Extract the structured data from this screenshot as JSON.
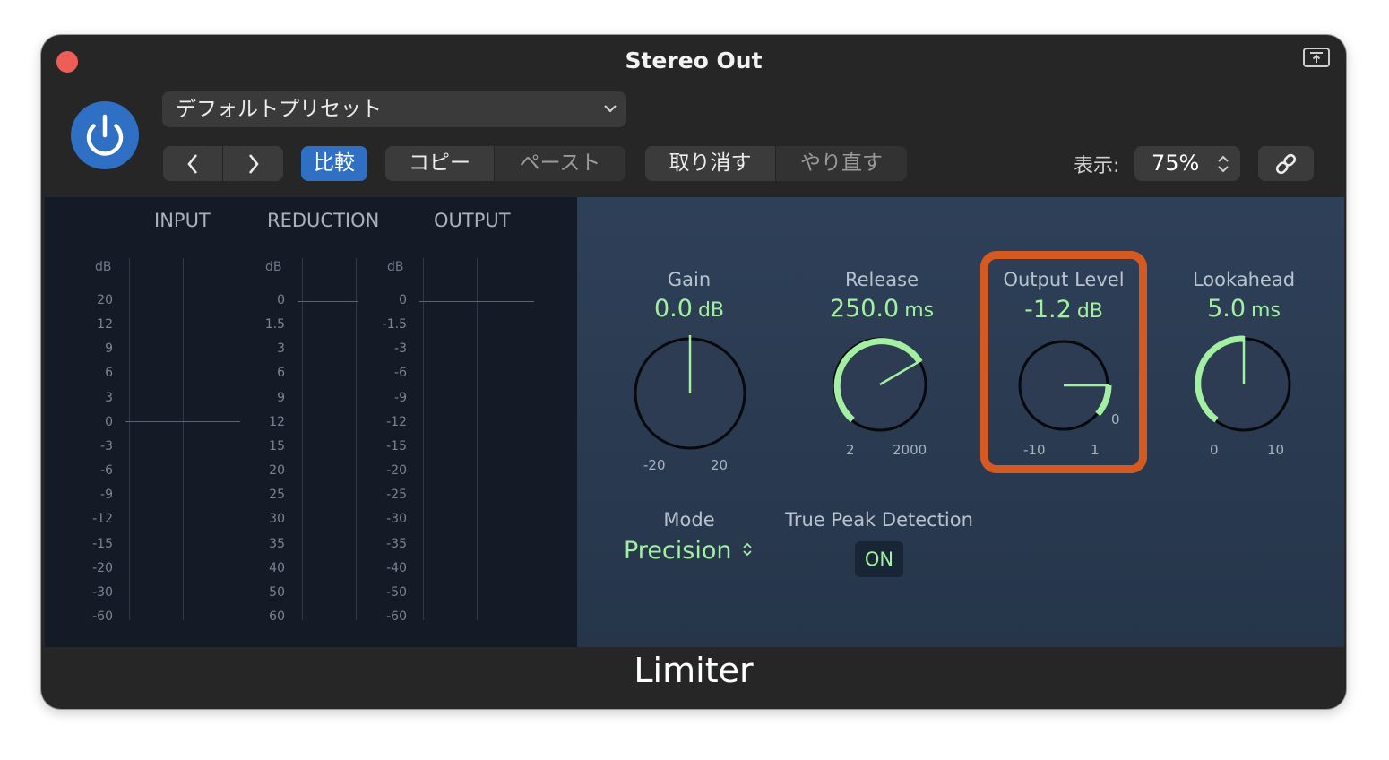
{
  "window": {
    "title": "Stereo Out"
  },
  "toolbar": {
    "preset": "デフォルトプリセット",
    "compare": "比較",
    "copy": "コピー",
    "paste": "ペースト",
    "undo": "取り消す",
    "redo": "やり直す",
    "zoom_label": "表示:",
    "zoom_value": "75%"
  },
  "meters": {
    "headers": [
      "INPUT",
      "REDUCTION",
      "OUTPUT"
    ],
    "db_label": "dB",
    "input_scale": [
      "20",
      "12",
      "9",
      "6",
      "3",
      "0",
      "-3",
      "-6",
      "-9",
      "-12",
      "-15",
      "-20",
      "-30",
      "-60"
    ],
    "reduction_scale": [
      "0",
      "1.5",
      "3",
      "6",
      "9",
      "12",
      "15",
      "20",
      "25",
      "30",
      "35",
      "40",
      "50",
      "60"
    ],
    "output_scale": [
      "0",
      "-1.5",
      "-3",
      "-6",
      "-9",
      "-12",
      "-15",
      "-20",
      "-25",
      "-30",
      "-35",
      "-40",
      "-50",
      "-60"
    ]
  },
  "controls": {
    "gain": {
      "label": "Gain",
      "value": "0.0",
      "unit": "dB",
      "min": "-20",
      "max": "20"
    },
    "release": {
      "label": "Release",
      "value": "250.0",
      "unit": "ms",
      "min": "2",
      "max": "2000"
    },
    "output_level": {
      "label": "Output Level",
      "value": "-1.2",
      "unit": "dB",
      "min": "-10",
      "max": "1",
      "zero": "0"
    },
    "lookahead": {
      "label": "Lookahead",
      "value": "5.0",
      "unit": "ms",
      "min": "0",
      "max": "10"
    },
    "mode": {
      "label": "Mode",
      "value": "Precision"
    },
    "true_peak": {
      "label": "True Peak Detection",
      "value": "ON"
    }
  },
  "footer": {
    "plugin_name": "Limiter"
  },
  "colors": {
    "accent_blue": "#2f6fc4",
    "value_green": "#a3f0a3",
    "highlight": "#d45a22",
    "close": "#ee5e56"
  }
}
